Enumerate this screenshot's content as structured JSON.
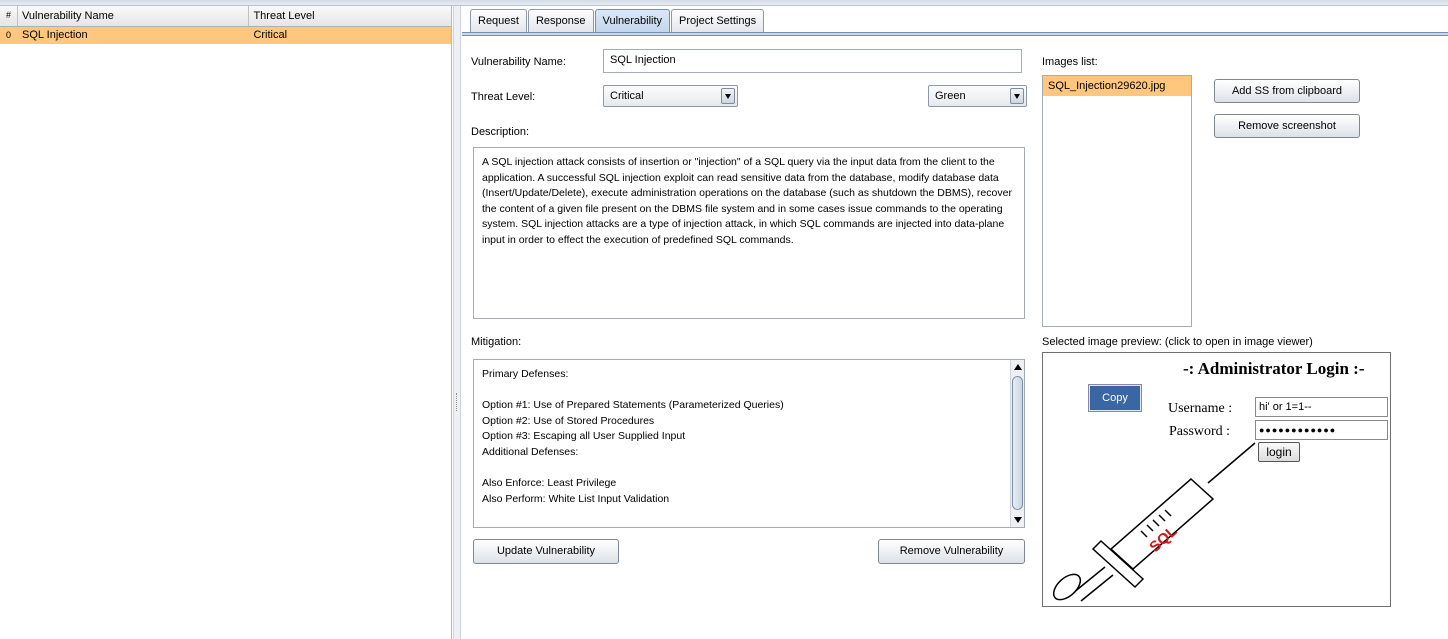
{
  "vuln_table": {
    "headers": {
      "index": "#",
      "name": "Vulnerability Name",
      "level": "Threat Level"
    },
    "rows": [
      {
        "index": "0",
        "name": "SQL Injection",
        "level": "Critical"
      }
    ]
  },
  "tabs": [
    "Request",
    "Response",
    "Vulnerability",
    "Project Settings"
  ],
  "active_tab": "Vulnerability",
  "form": {
    "name_label": "Vulnerability Name:",
    "name_value": "SQL Injection",
    "threat_label": "Threat Level:",
    "threat_value": "Critical",
    "color_value": "Green",
    "description_label": "Description:",
    "description_lines": [
      "A SQL injection attack consists of insertion or \"injection\" of a SQL query via the input data from the client to the",
      "application. A successful SQL injection exploit can read sensitive data from the database, modify database data",
      "(Insert/Update/Delete), execute administration operations on the database (such as shutdown the DBMS), recover",
      "the content of a given file present on the DBMS file system and in some cases issue commands to the operating",
      "system. SQL injection attacks are a type of injection attack, in which SQL commands are injected into data-plane",
      "input in order to effect the execution of predefined SQL commands."
    ],
    "mitigation_label": "Mitigation:",
    "mitigation_lines": [
      "Primary Defenses:",
      "",
      "Option #1: Use of Prepared Statements (Parameterized Queries)",
      "Option #2: Use of Stored Procedures",
      "Option #3: Escaping all User Supplied Input",
      "Additional Defenses:",
      "",
      "Also Enforce: Least Privilege",
      "Also Perform: White List Input Validation"
    ],
    "update_button": "Update Vulnerability",
    "remove_button": "Remove Vulnerability"
  },
  "images": {
    "label": "Images list:",
    "items": [
      "SQL_Injection29620.jpg"
    ],
    "add_button": "Add SS from clipboard",
    "remove_button": "Remove screenshot",
    "preview_label": "Selected image preview: (click to open in image viewer)"
  },
  "preview": {
    "title": "-: Administrator Login :-",
    "username_label": "Username :",
    "username_value": "hi' or 1=1--",
    "password_label": "Password :",
    "password_value": "●●●●●●●●●●●●",
    "login_button": "login",
    "copy_button": "Copy",
    "syringe_text": "SQL"
  },
  "colors": {
    "selected_row": "#ffc77d",
    "tab_active": "#c3d6ec"
  }
}
